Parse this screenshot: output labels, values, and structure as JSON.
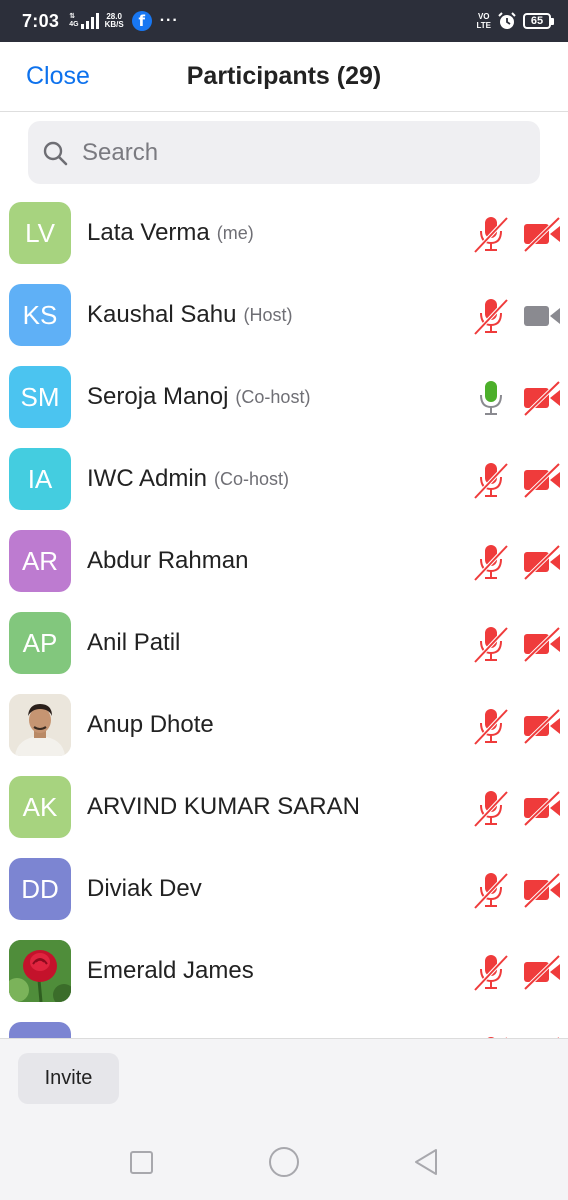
{
  "status_bar": {
    "time": "7:03",
    "network_type": "4G",
    "speed_value": "28.0",
    "speed_unit": "KB/S",
    "volte_top": "VO",
    "volte_bottom": "LTE",
    "battery": "65",
    "icons": [
      "signal-icon",
      "facebook-icon",
      "more-dots-icon",
      "alarm-icon",
      "battery-icon"
    ]
  },
  "header": {
    "close_label": "Close",
    "title": "Participants (29)"
  },
  "search": {
    "placeholder": "Search"
  },
  "colors": {
    "accent": "#0e72ed",
    "muted_red": "#ef3b3b",
    "active_green": "#4caf2a",
    "camera_on_gray": "#8a8a90"
  },
  "participants": [
    {
      "initials": "LV",
      "name": "Lata Verma",
      "role": "(me)",
      "avatar_color": "#a7d37f",
      "mic": "muted",
      "video": "off"
    },
    {
      "initials": "KS",
      "name": "Kaushal Sahu",
      "role": "(Host)",
      "avatar_color": "#5fb0f6",
      "mic": "muted",
      "video": "on"
    },
    {
      "initials": "SM",
      "name": "Seroja Manoj",
      "role": "(Co-host)",
      "avatar_color": "#4bc4f0",
      "mic": "active",
      "video": "off"
    },
    {
      "initials": "IA",
      "name": "IWC Admin",
      "role": "(Co-host)",
      "avatar_color": "#44cde0",
      "mic": "muted",
      "video": "off"
    },
    {
      "initials": "AR",
      "name": "Abdur Rahman",
      "role": "",
      "avatar_color": "#bd7bd0",
      "mic": "muted",
      "video": "off"
    },
    {
      "initials": "AP",
      "name": "Anil Patil",
      "role": "",
      "avatar_color": "#82c77d",
      "mic": "muted",
      "video": "off"
    },
    {
      "initials": "",
      "name": "Anup Dhote",
      "role": "",
      "avatar_color": "#e9e3d8",
      "avatar_type": "photo-person",
      "mic": "muted",
      "video": "off"
    },
    {
      "initials": "AK",
      "name": "ARVIND KUMAR SARAN",
      "role": "",
      "avatar_color": "#a7d37f",
      "mic": "muted",
      "video": "off"
    },
    {
      "initials": "DD",
      "name": "Diviak Dev",
      "role": "",
      "avatar_color": "#7c85d2",
      "mic": "muted",
      "video": "off"
    },
    {
      "initials": "",
      "name": "Emerald James",
      "role": "",
      "avatar_color": "#3d7a2c",
      "avatar_type": "photo-rose",
      "mic": "muted",
      "video": "off"
    },
    {
      "initials": "",
      "name": "",
      "role": "",
      "avatar_color": "#7c85d2",
      "mic": "muted",
      "video": "off"
    }
  ],
  "footer": {
    "invite_label": "Invite"
  }
}
